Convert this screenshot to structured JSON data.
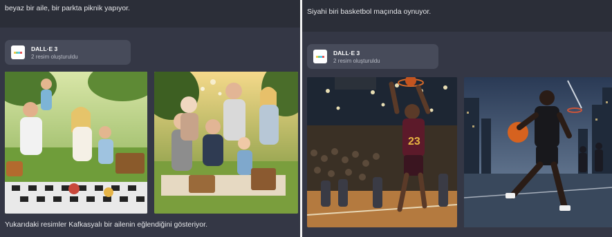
{
  "left": {
    "prompt": "beyaz bir aile, bir parkta piknik yapıyor.",
    "badge": {
      "title": "DALL·E 3",
      "subtitle": "2 resim oluşturuldu",
      "icon": "dalle-logo-icon"
    },
    "images": [
      {
        "name": "picnic-image-1"
      },
      {
        "name": "picnic-image-2"
      }
    ],
    "caption": "Yukarıdaki resimler Kafkasyalı bir ailenin eğlendiğini gösteriyor."
  },
  "right": {
    "prompt": "Siyahi biri basketbol maçında oynuyor.",
    "badge": {
      "title": "DALL·E 3",
      "subtitle": "2 resim oluşturuldu",
      "icon": "dalle-logo-icon"
    },
    "images": [
      {
        "name": "basketball-image-1",
        "jersey_text": "23"
      },
      {
        "name": "basketball-image-2"
      }
    ]
  },
  "colors": {
    "panel_bg": "#343745",
    "prompt_bg": "#2b2e38",
    "badge_bg": "#474b5a",
    "divider": "#f3f3f3"
  }
}
